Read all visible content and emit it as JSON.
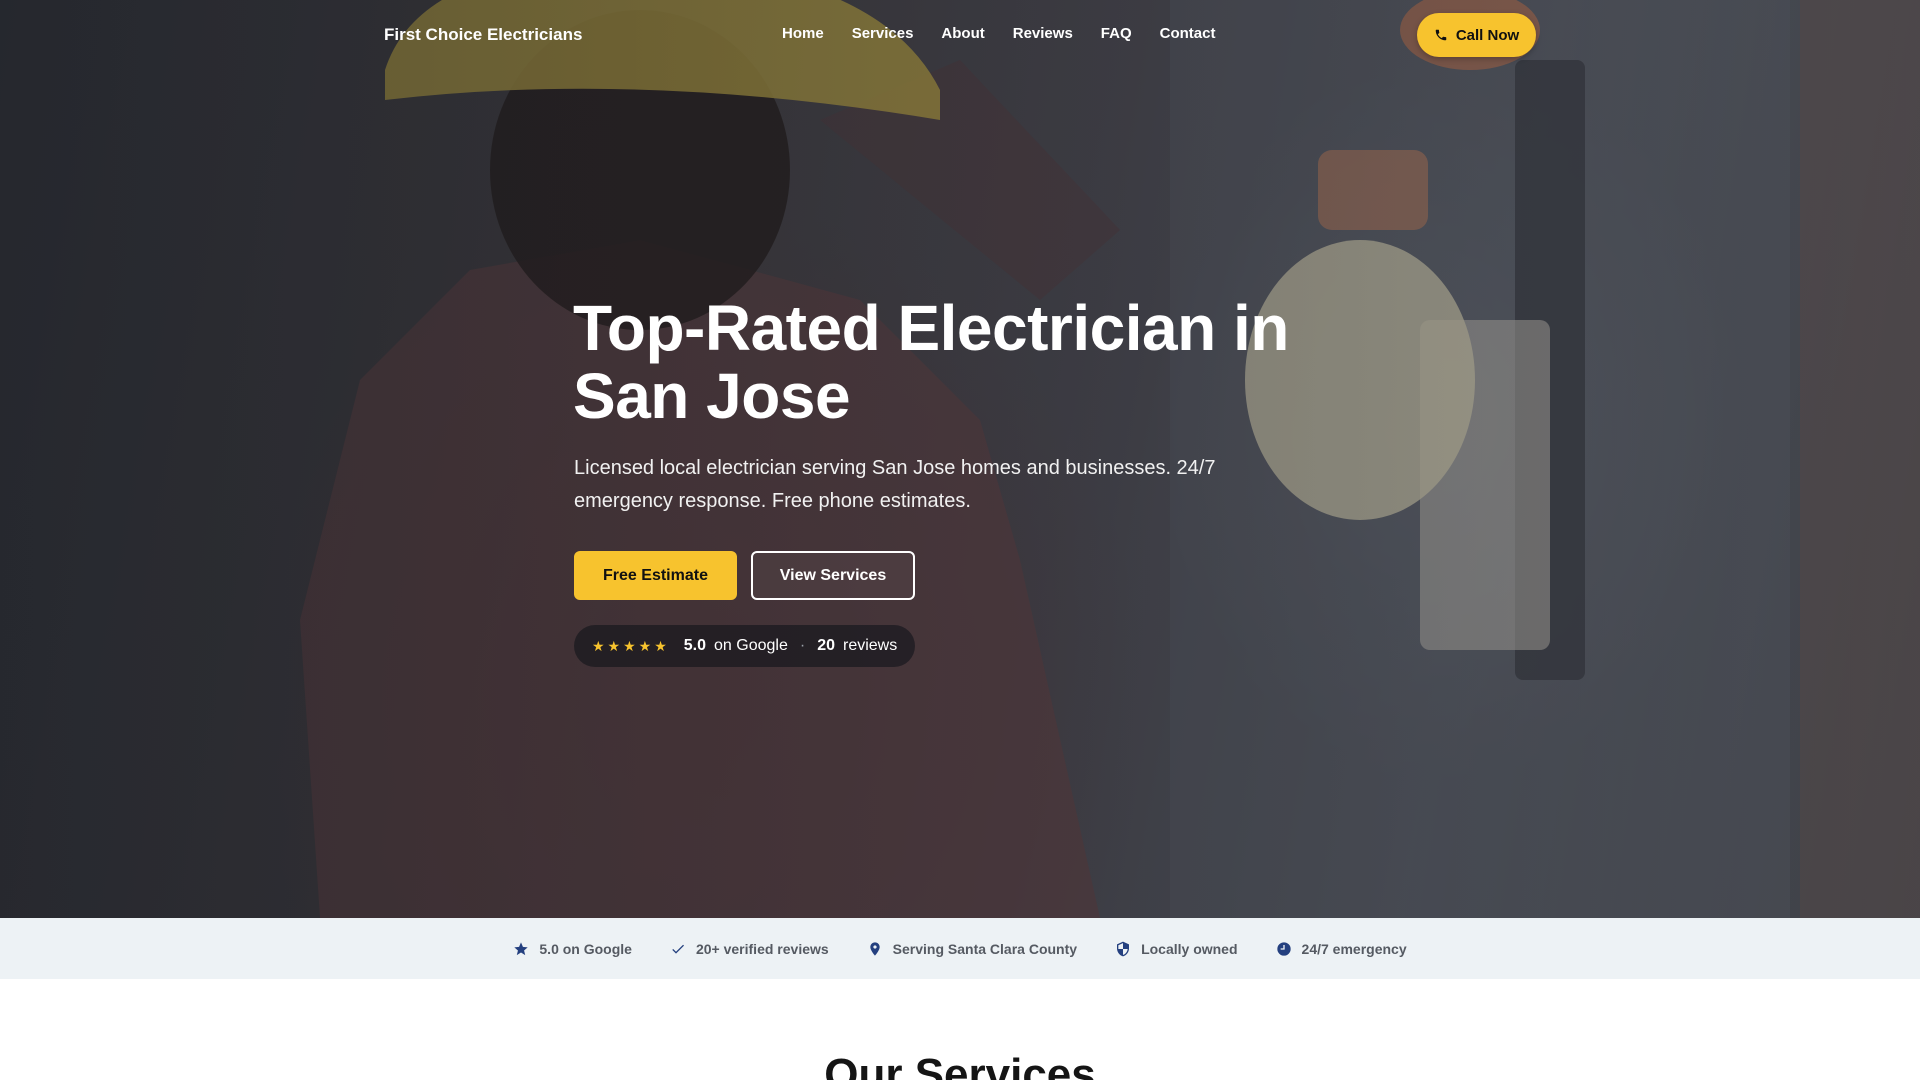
{
  "nav": {
    "brand": "First Choice Electricians",
    "links": [
      "Home",
      "Services",
      "About",
      "Reviews",
      "FAQ",
      "Contact"
    ],
    "call_label": "Call Now"
  },
  "hero": {
    "title": "Top-Rated Electrician in San Jose",
    "subtitle": "Licensed local electrician serving San Jose homes and businesses. 24/7 emergency response. Free phone estimates.",
    "primary_cta": "Free Estimate",
    "secondary_cta": "View Services",
    "rating": {
      "stars": "★★★★★",
      "score": "5.0",
      "score_suffix": "on Google",
      "count": "20",
      "count_suffix": "reviews"
    }
  },
  "trust_bar": {
    "items": [
      {
        "icon": "star-icon",
        "label": "5.0 on Google"
      },
      {
        "icon": "check-icon",
        "label": "20+ verified reviews"
      },
      {
        "icon": "location-pin-icon",
        "label": "Serving Santa Clara County"
      },
      {
        "icon": "shield-icon",
        "label": "Locally owned"
      },
      {
        "icon": "clock-icon",
        "label": "24/7 emergency"
      }
    ]
  },
  "services": {
    "title": "Our Services"
  },
  "colors": {
    "accent": "#f7c32e",
    "trust_bg": "#edf2f5",
    "icon_blue": "#24407f"
  }
}
